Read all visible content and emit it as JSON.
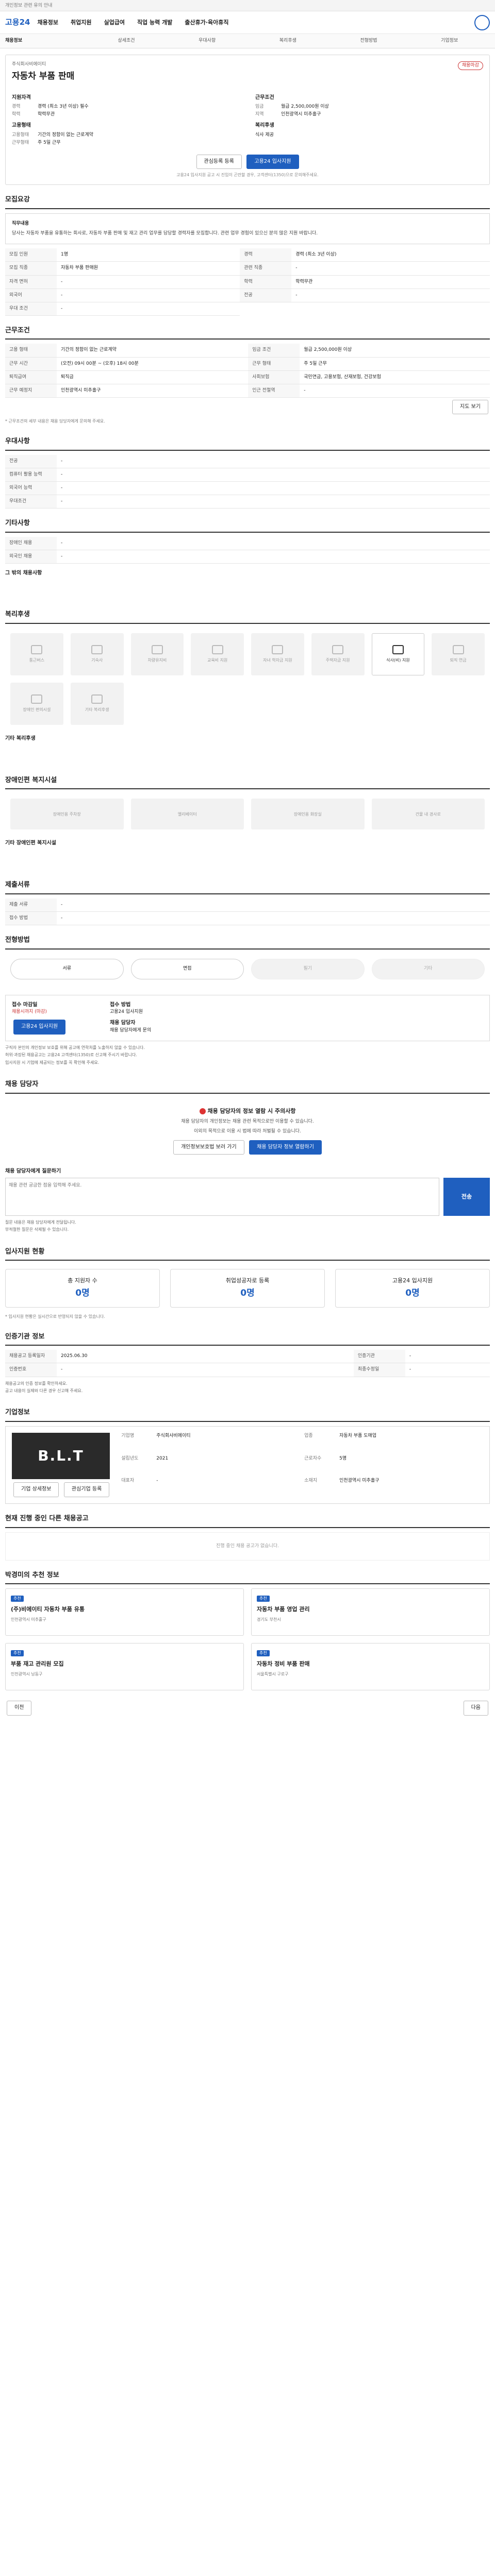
{
  "topbar": {
    "notice": "개인정보 관련 유의 안내"
  },
  "header": {
    "logo": "고용24",
    "nav": [
      "채용정보",
      "취업지원",
      "실업급여",
      "직업 능력 개발",
      "출산휴가·육아휴직"
    ]
  },
  "subnav": [
    "채용정보",
    "상세조건",
    "우대사항",
    "복리후생",
    "전형방법",
    "기업정보"
  ],
  "job": {
    "company_label": "주식회사비에이티",
    "title": "자동차 부품 판매",
    "badge": "채용마감",
    "qual_label": "지원자격",
    "qual": [
      [
        "경력",
        "경력 (최소 3년 이상) 필수"
      ],
      [
        "학력",
        "학력무관"
      ]
    ],
    "cond_label": "근무조건",
    "cond": [
      [
        "임금",
        "월급 2,500,000원 이상"
      ],
      [
        "지역",
        "인천광역시 미추홀구"
      ]
    ],
    "type_label": "고용형태",
    "type": [
      [
        "고용형태",
        "기간의 정함이 없는 근로계약"
      ],
      [
        "근무형태",
        "주 5일 근무"
      ]
    ],
    "welfare_label": "복리후생",
    "welfare": "식사 제공",
    "share": "관심등록 등록",
    "apply": "고용24 입사지원",
    "note": "고용24 입사지원 공고 시 진입이 곤란할 경우, 고객센터(1350)으로 문의해주세요."
  },
  "summary": {
    "title": "모집요강",
    "head": "직무내용",
    "body": "당사는 자동차 부품을 유통하는 회사로, 자동차 부품 판매 및 재고 관리 업무를 담당할 경력자를 모집합니다. 관련 업무 경험이 있으신 분의 많은 지원 바랍니다."
  },
  "apply_cond": [
    [
      "모집 인원",
      "1명"
    ],
    [
      "경력",
      "경력 (최소 3년 이상)"
    ],
    [
      "모집 직종",
      "자동차 부품 판매원"
    ],
    [
      "관련 직종",
      "-"
    ],
    [
      "자격 면허",
      "-"
    ],
    [
      "학력",
      "학력무관"
    ],
    [
      "외국어",
      "-"
    ],
    [
      "전공",
      "-"
    ],
    [
      "우대 조건",
      "-"
    ]
  ],
  "work": {
    "title": "근무조건",
    "rows": [
      [
        "고용 형태",
        "기간의 정함이 없는 근로계약"
      ],
      [
        "임금 조건",
        "월급 2,500,000원 이상"
      ],
      [
        "근무 시간",
        "(오전) 09시 00분 ~ (오후) 18시 00분"
      ],
      [
        "근무 형태",
        "주 5일 근무"
      ],
      [
        "퇴직급여",
        "퇴직금"
      ],
      [
        "사회보험",
        "국민연금, 고용보험, 산재보험, 건강보험"
      ],
      [
        "근무 예정지",
        "인천광역시 미추홀구"
      ],
      [
        "인근 전철역",
        "-"
      ]
    ],
    "map": "지도 보기",
    "foot": "* 근무조건의 세부 내용은 채용 담당자에게 문의해 주세요."
  },
  "pref": {
    "title": "우대사항",
    "rows": [
      [
        "전공",
        "-"
      ],
      [
        "컴퓨터 활용 능력",
        "-"
      ],
      [
        "외국어 능력",
        "-"
      ],
      [
        "우대조건",
        "-"
      ]
    ]
  },
  "other": {
    "title": "기타사항",
    "rows": [
      [
        "장애인 채용",
        "-"
      ],
      [
        "외국인 채용",
        "-"
      ]
    ],
    "extra": "그 밖의 채용사항"
  },
  "welfare": {
    "title": "복리후생",
    "items": [
      "통근버스",
      "기숙사",
      "차량유지비",
      "교육비 지원",
      "자녀 학자금 지원",
      "주택자금 지원",
      "식사(비) 지원",
      "퇴직 연금",
      "장애인 편의시설",
      "기타 복리후생"
    ],
    "active": 6,
    "etc_label": "기타 복리후생"
  },
  "disabled": {
    "title": "장애인편 복지시설",
    "items": [
      "장애인용 주차장",
      "엘리베이터",
      "장애인용 화장실",
      "건물 내 경사로"
    ],
    "etc_label": "기타 장애인편 복지시설"
  },
  "doc": {
    "title": "제출서류",
    "rows": [
      [
        "제출 서류",
        "-"
      ],
      [
        "접수 방법",
        "-"
      ]
    ]
  },
  "process": {
    "title": "전형방법",
    "steps": [
      "서류",
      "면접",
      "필기",
      "기타"
    ],
    "active": [
      0,
      1
    ]
  },
  "receipt": {
    "title": "접수 마감일",
    "deadline": "채용시까지 (마감)",
    "apply": "고용24 입사지원",
    "method_label": "접수 방법",
    "method": "고용24 입사지원",
    "contact_label": "채용 담당자",
    "contact": "채용 담당자에게 문의",
    "bullets": [
      "구직자 본인의 개인정보 보호를 위해 공고에 연락처를 노출하지 않을 수 있습니다.",
      "허위·과장된 채용공고는 고용24 고객센터(1350)로 신고해 주시기 바랍니다.",
      "입사지원 시 기업에 제공되는 정보를 꼭 확인해 주세요."
    ]
  },
  "manager": {
    "title": "채용 담당자",
    "warn": "채용 담당자의 정보 열람 시 주의사항",
    "p1": "채용 담당자의 개인정보는 채용 관련 목적으로만 이용할 수 있습니다.",
    "p2": "이외의 목적으로 이용 시 법에 따라 처벌될 수 있습니다.",
    "b1": "개인정보보호법 보러 가기",
    "b2": "채용 담당자 정보 열람하기",
    "q_title": "채용 담당자에게 질문하기",
    "q_placeholder": "채용 관련 궁금한 점을 입력해 주세요.",
    "send": "전송",
    "bullets": [
      "질문 내용은 채용 담당자에게 전달됩니다.",
      "부적절한 질문은 삭제될 수 있습니다."
    ]
  },
  "stats": {
    "title": "입사지원 현황",
    "items": [
      [
        "총 지원자 수",
        "0명"
      ],
      [
        "취업성공자로 등록",
        "0명"
      ],
      [
        "고용24 입사지원",
        "0명"
      ]
    ],
    "note": "* 입사지원 현황은 실시간으로 반영되지 않을 수 있습니다."
  },
  "org": {
    "title": "인증기관 정보",
    "rows": [
      [
        "채용공고 등록일자",
        "2025.06.30"
      ],
      [
        "인증기관",
        "-"
      ],
      [
        "인증번호",
        "-"
      ],
      [
        "최종수정일",
        "-"
      ]
    ],
    "bullets": [
      "채용공고의 인증 정보를 확인하세요.",
      "공고 내용이 실제와 다른 경우 신고해 주세요."
    ]
  },
  "company": {
    "title": "기업정보",
    "logo": "B.L.T",
    "fields": [
      [
        "기업명",
        "주식회사비에이티"
      ],
      [
        "업종",
        "자동차 부품 도매업"
      ],
      [
        "설립년도",
        "2021"
      ],
      [
        "근로자수",
        "5명"
      ],
      [
        "대표자",
        "-"
      ],
      [
        "소재지",
        "인천광역시 미추홀구"
      ]
    ],
    "b1": "기업 상세정보",
    "b2": "관심기업 등록"
  },
  "others": {
    "title": "현재 진행 중인 다른 채용공고",
    "empty": "진행 중인 채용 공고가 없습니다."
  },
  "recommend": {
    "title": "박경미의 추천 정보",
    "cards": [
      {
        "tag": "추천",
        "t": "(주)비에이티 자동차 부품 유통",
        "m": "인천광역시 미추홀구"
      },
      {
        "tag": "추천",
        "t": "자동차 부품 영업 관리",
        "m": "경기도 부천시"
      },
      {
        "tag": "추천",
        "t": "부품 재고 관리원 모집",
        "m": "인천광역시 남동구"
      },
      {
        "tag": "추천",
        "t": "자동차 정비 부품 판매",
        "m": "서울특별시 구로구"
      }
    ]
  },
  "pager": {
    "prev": "이전",
    "next": "다음"
  }
}
